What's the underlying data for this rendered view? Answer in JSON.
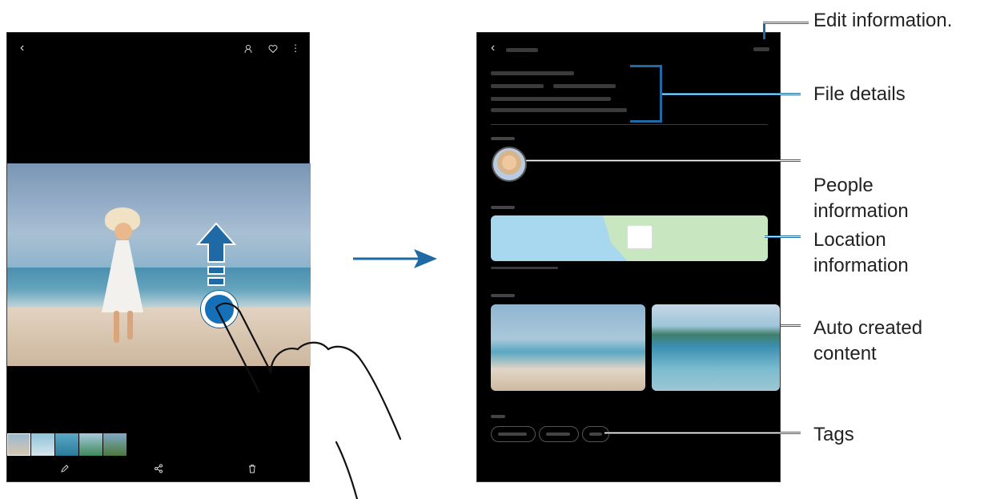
{
  "callouts": {
    "edit_information": "Edit information.",
    "file_details": "File details",
    "people_information": "People\ninformation",
    "location_information": "Location\ninformation",
    "auto_created_content": "Auto created\ncontent",
    "tags": "Tags"
  },
  "icons": {
    "back": "‹",
    "people": "person-icon",
    "favorite": "heart-icon",
    "more": "more-vert-icon",
    "edit": "pencil-icon",
    "share": "share-icon",
    "delete": "trash-icon"
  },
  "colors": {
    "accent": "#1f6aa5",
    "screen_bg": "#000000"
  }
}
